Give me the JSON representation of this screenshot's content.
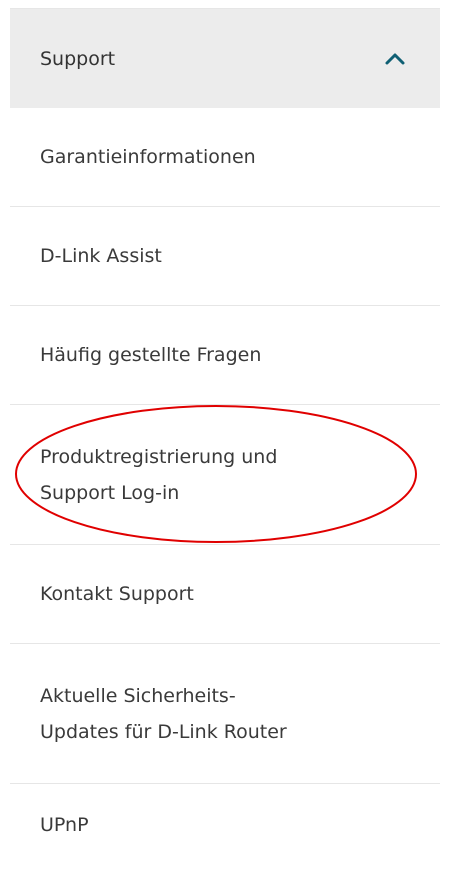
{
  "menu": {
    "header": {
      "label": "Support",
      "icon": "chevron-up-icon",
      "accent_color": "#0f5f73"
    },
    "items": [
      {
        "label": "Garantieinformationen"
      },
      {
        "label": "D-Link Assist"
      },
      {
        "label": "Häufig gestellte Fragen"
      },
      {
        "label_line1": "Produktregistrierung und",
        "label_line2": "Support Log-in"
      },
      {
        "label": "Kontakt Support"
      },
      {
        "label_line1": "Aktuelle Sicherheits-",
        "label_line2": "Updates für D-Link Router"
      },
      {
        "label": "UPnP"
      }
    ]
  },
  "annotation": {
    "shape": "ellipse",
    "color": "#e00000"
  }
}
